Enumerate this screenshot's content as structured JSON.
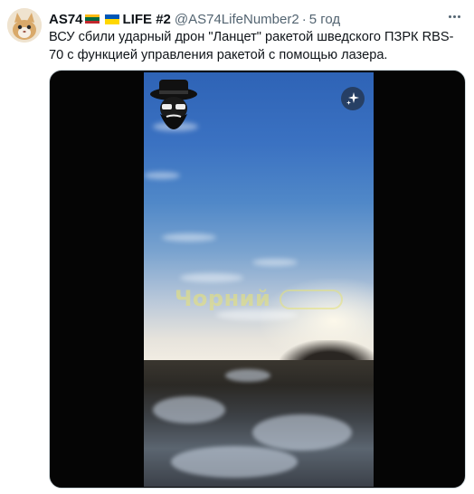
{
  "author": {
    "display_name": "AS74",
    "display_name_suffix": "LIFE #2",
    "handle": "@AS74LifeNumber2",
    "separator": "·",
    "time": "5 год"
  },
  "tweet": {
    "text": "ВСУ сбили ударный дрон \"Ланцет\" ракетой шведского ПЗРК RBS-70 с функцией управления ракетой с помощью лазера."
  },
  "media": {
    "watermark_text": "Чорний"
  },
  "icons": {
    "avatar": "cat-avatar",
    "flag_1": "lithuania-flag-icon",
    "flag_2": "ukraine-flag-icon",
    "more": "more-options-icon",
    "channel_logo": "bearded-man-hat-logo",
    "sparkle": "sparkle-icon"
  },
  "colors": {
    "lt_yellow": "#fdb913",
    "lt_green": "#006a44",
    "lt_red": "#c1272d",
    "ua_blue": "#0057b7",
    "ua_yellow": "#ffd700",
    "secondary_text": "#536471"
  }
}
